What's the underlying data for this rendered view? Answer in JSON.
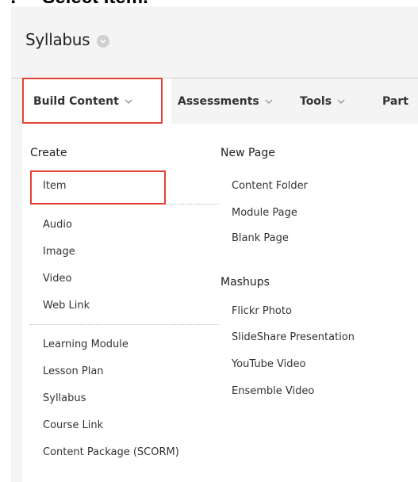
{
  "instruction": "Select Item.",
  "course": {
    "page_title": "Syllabus"
  },
  "menubar": {
    "items": [
      {
        "label": "Build Content"
      },
      {
        "label": "Assessments"
      },
      {
        "label": "Tools"
      },
      {
        "label": "Part"
      }
    ]
  },
  "dropdown": {
    "create": {
      "title": "Create",
      "items": [
        "Item",
        "Audio",
        "Image",
        "Video",
        "Web Link",
        "Learning Module",
        "Lesson Plan",
        "Syllabus",
        "Course Link",
        "Content Package (SCORM)"
      ]
    },
    "new_page": {
      "title": "New Page",
      "items": [
        "Content Folder",
        "Module Page",
        "Blank Page"
      ]
    },
    "mashups": {
      "title": "Mashups",
      "items": [
        "Flickr Photo",
        "SlideShare Presentation",
        "YouTube Video",
        "Ensemble Video"
      ]
    }
  },
  "colors": {
    "highlight": "#e34234",
    "panel_bg": "#f4f4f4",
    "dropdown_bg": "#ffffff"
  }
}
